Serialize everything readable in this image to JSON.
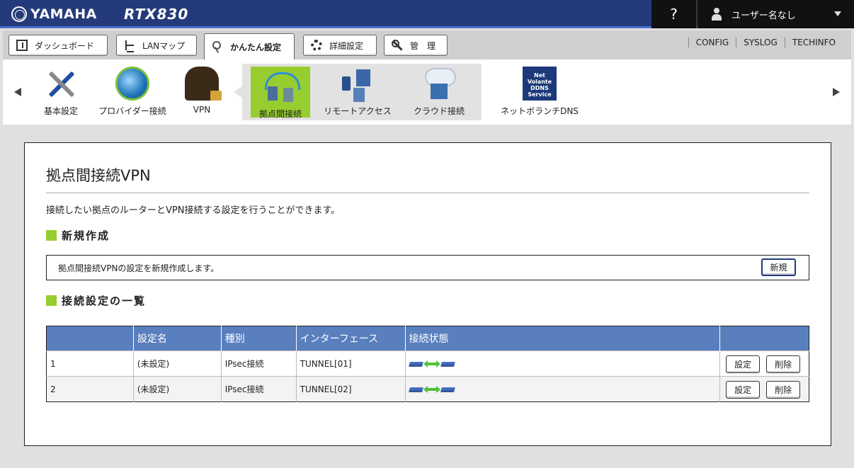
{
  "header": {
    "brand": "YAMAHA",
    "model": "RTX830",
    "help_label": "?",
    "user_label": "ユーザー名なし"
  },
  "tabs": [
    {
      "label": "ダッシュボード",
      "icon": "dashboard-icon"
    },
    {
      "label": "LANマップ",
      "icon": "lan-map-icon"
    },
    {
      "label": "かんたん設定",
      "icon": "key-icon",
      "active": true
    },
    {
      "label": "詳細設定",
      "icon": "gear-icon"
    },
    {
      "label": "管　理",
      "icon": "wrench-icon"
    }
  ],
  "toplinks": [
    "CONFIG",
    "SYSLOG",
    "TECHINFO"
  ],
  "strip": {
    "items": [
      {
        "label": "基本設定",
        "icon": "tools-icon"
      },
      {
        "label": "プロバイダー接続",
        "icon": "globe-icon"
      },
      {
        "label": "VPN",
        "icon": "vpn-icon"
      },
      {
        "label": "拠点間接続",
        "icon": "site-link-icon",
        "selected": true
      },
      {
        "label": "リモートアクセス",
        "icon": "remote-access-icon"
      },
      {
        "label": "クラウド接続",
        "icon": "cloud-icon"
      },
      {
        "label": "ネットボランチDNS",
        "icon": "ddns-icon"
      }
    ],
    "ddns_logo": {
      "line1": "Net",
      "line2": "Volante",
      "line3": "DDNS",
      "line4": "Service"
    }
  },
  "page": {
    "title": "拠点間接続VPN",
    "description": "接続したい拠点のルーターとVPN接続する設定を行うことができます。",
    "new_section_title": "新規作成",
    "new_text": "拠点間接続VPNの設定を新規作成します。",
    "new_button": "新規",
    "list_section_title": "接続設定の一覧"
  },
  "table": {
    "headers": [
      "",
      "設定名",
      "種別",
      "インターフェース",
      "接続状態",
      ""
    ],
    "rows": [
      {
        "no": "1",
        "name": "(未設定)",
        "type": "IPsec接続",
        "interface": "TUNNEL[01]",
        "edit": "設定",
        "delete": "削除"
      },
      {
        "no": "2",
        "name": "(未設定)",
        "type": "IPsec接続",
        "interface": "TUNNEL[02]",
        "edit": "設定",
        "delete": "削除"
      }
    ]
  },
  "colors": {
    "header_bg": "#243a7a",
    "accent_green": "#97cd2e",
    "table_header": "#5a7fbf"
  }
}
